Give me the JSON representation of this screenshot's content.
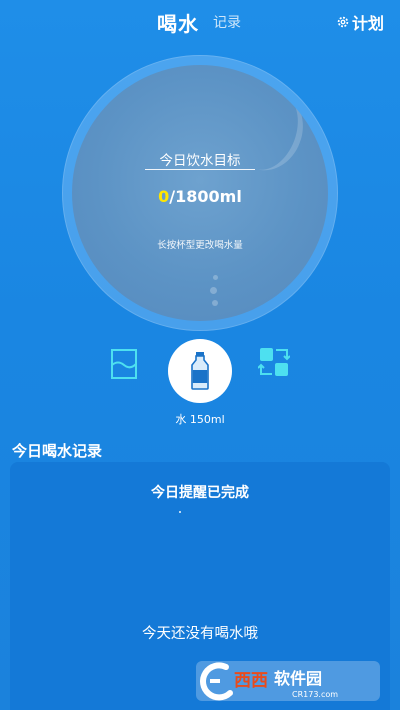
{
  "header": {
    "tab_active": "喝水",
    "tab_inactive": "记录",
    "plan_label": "计划",
    "plan_icon": "gear-icon"
  },
  "goal": {
    "label": "今日饮水目标",
    "current": "0",
    "separator": "/",
    "target": "1800ml",
    "hint": "长按杯型更改喝水量"
  },
  "cup": {
    "left_icon": "wave-glass-icon",
    "center_icon": "water-bottle-icon",
    "right_icon": "swap-icon",
    "label": "水 150ml"
  },
  "record": {
    "title": "今日喝水记录",
    "status": "今日提醒已完成",
    "empty_text": "今天还没有喝水哦"
  },
  "watermark": {
    "brand": "西西软件园",
    "url": "CR173.com"
  },
  "colors": {
    "background": "#1f8ee8",
    "accent_yellow": "#ffe600",
    "teal_icon": "#4de0f0",
    "card": "#1479d7"
  }
}
